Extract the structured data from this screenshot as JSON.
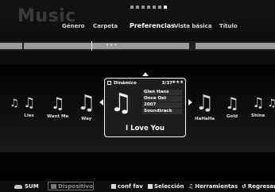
{
  "app": {
    "title": "Music"
  },
  "page_dots": {
    "count": 7,
    "active_index": 6
  },
  "tabs": [
    {
      "label": "Género",
      "active": false
    },
    {
      "label": "Carpeta",
      "active": false
    },
    {
      "label": "Preferencias",
      "active": true
    },
    {
      "label": "Vista básica",
      "active": false
    },
    {
      "label": "Título",
      "active": false
    }
  ],
  "progress_bar": {
    "indicator": "•••"
  },
  "carousel": {
    "left_items": [
      "Lies",
      "Want Me",
      "Way"
    ],
    "right_items": [
      "HaHaHa",
      "Gold",
      "Shine"
    ],
    "note_glyph": "♫"
  },
  "selected": {
    "mode_label": "Dinámico",
    "counter": "3/37",
    "stars": "★★★",
    "metadata": [
      "Glen Hans",
      "Once Ost",
      "2007",
      "Soundtrack"
    ],
    "title": "I Love You"
  },
  "footer": {
    "sum_label": "SUM",
    "device_label": "Dispositivo",
    "conf_fav_label": "conf fav",
    "selection_label": "Selección",
    "tools_label": "Herramientas",
    "return_label": "Regresar",
    "tools_icon": "♫",
    "return_icon": "↺"
  },
  "colors": {
    "background": "#000000",
    "card_border": "#ffffff",
    "text": "#ffffff",
    "muted": "#3a3a3a"
  }
}
